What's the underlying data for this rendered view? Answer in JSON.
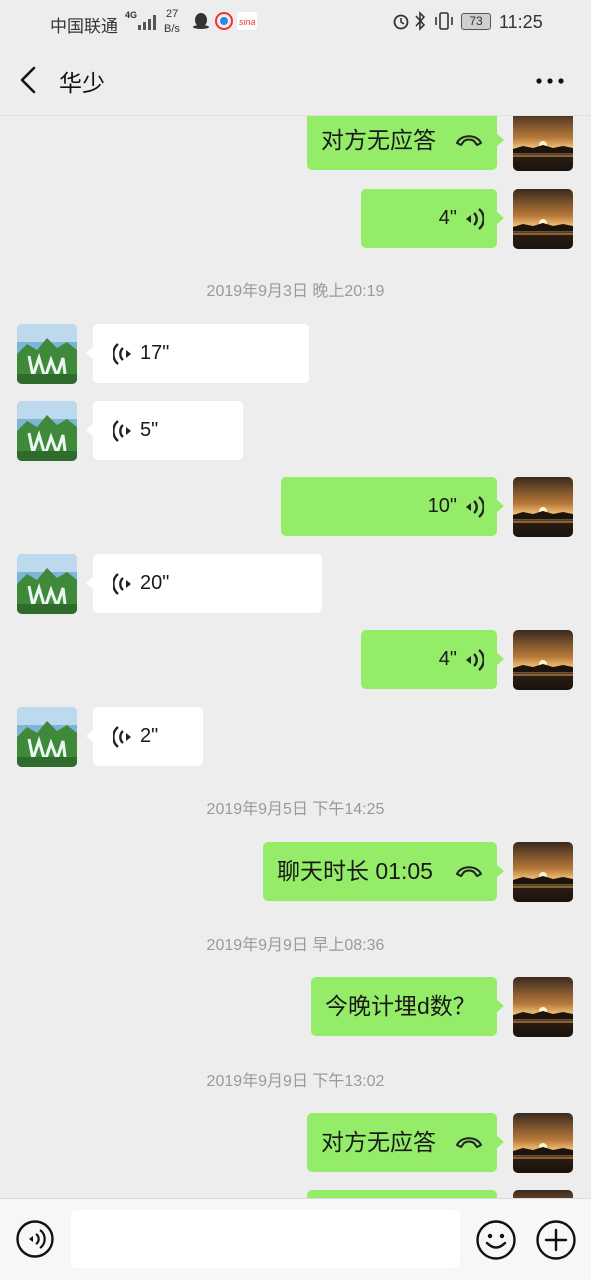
{
  "status_bar": {
    "carrier": "中国联通",
    "network": "4G",
    "speed_value": "27",
    "speed_unit": "B/s",
    "battery": "73",
    "time": "11:25"
  },
  "header": {
    "title": "华少"
  },
  "colors": {
    "background": "#ededed",
    "my_bubble": "#95ec69",
    "peer_bubble": "#ffffff",
    "timestamp": "#9a9a9a"
  },
  "messages": [
    {
      "side": "me",
      "kind": "call",
      "text": "对方无应答",
      "icon": "phone-hangup-icon"
    },
    {
      "side": "me",
      "kind": "voice",
      "text": "4\"",
      "icon": "voice-wave-icon"
    },
    {
      "kind": "timestamp",
      "text": "2019年9月3日 晚上20:19"
    },
    {
      "side": "peer",
      "kind": "voice",
      "text": "17\"",
      "icon": "voice-wave-icon"
    },
    {
      "side": "peer",
      "kind": "voice",
      "text": "5\"",
      "icon": "voice-wave-icon"
    },
    {
      "side": "me",
      "kind": "voice",
      "text": "10\"",
      "icon": "voice-wave-icon"
    },
    {
      "side": "peer",
      "kind": "voice",
      "text": "20\"",
      "icon": "voice-wave-icon"
    },
    {
      "side": "me",
      "kind": "voice",
      "text": "4\"",
      "icon": "voice-wave-icon"
    },
    {
      "side": "peer",
      "kind": "voice",
      "text": "2\"",
      "icon": "voice-wave-icon"
    },
    {
      "kind": "timestamp",
      "text": "2019年9月5日 下午14:25"
    },
    {
      "side": "me",
      "kind": "call",
      "text": "聊天时长 01:05",
      "icon": "phone-hangup-icon"
    },
    {
      "kind": "timestamp",
      "text": "2019年9月9日 早上08:36"
    },
    {
      "side": "me",
      "kind": "text",
      "text": "今晚计埋d数？"
    },
    {
      "kind": "timestamp",
      "text": "2019年9月9日 下午13:02"
    },
    {
      "side": "me",
      "kind": "call",
      "text": "对方无应答",
      "icon": "phone-hangup-icon"
    }
  ],
  "input_bar": {
    "placeholder": "",
    "voice_icon": "voice-input-icon",
    "emoji_icon": "emoji-icon",
    "more_icon": "plus-icon"
  }
}
